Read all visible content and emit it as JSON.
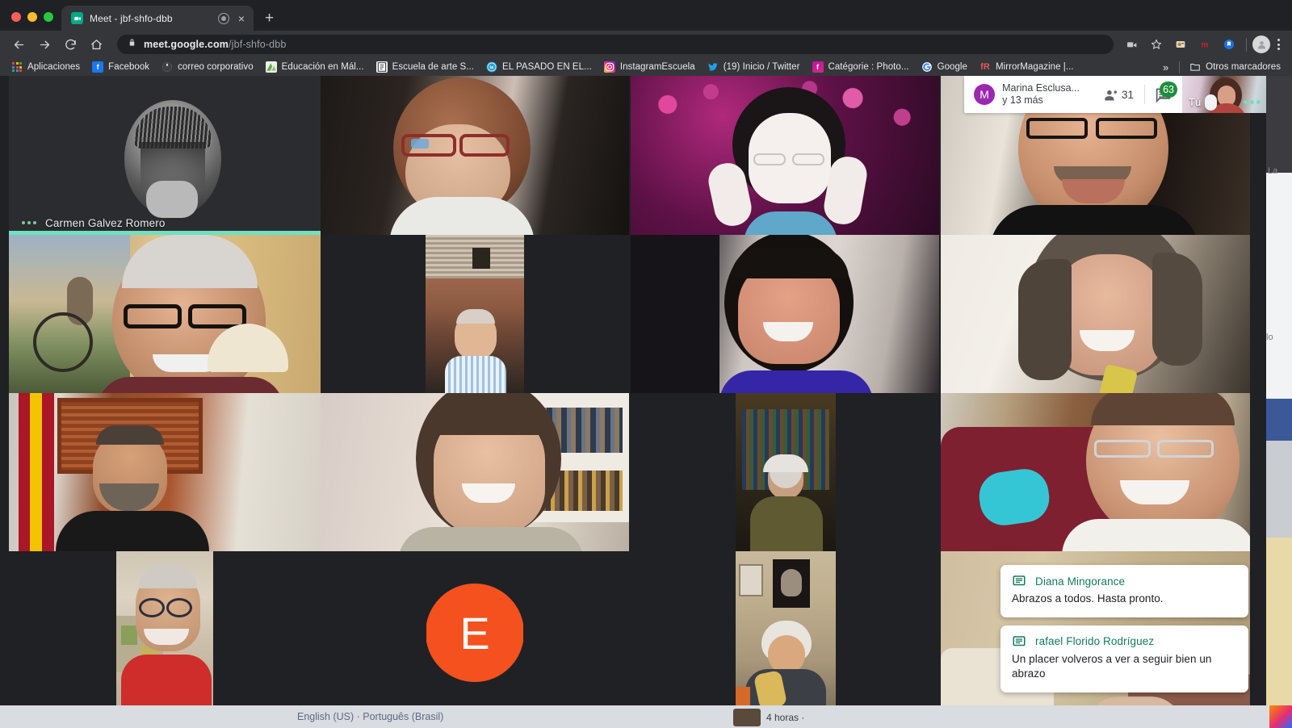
{
  "browser": {
    "tab": {
      "title": "Meet - jbf-shfo-dbb",
      "favicon": "meet-icon",
      "audio_indicator": "audio-playing-icon",
      "close": "×"
    },
    "newtab_label": "+",
    "nav": {
      "back": "back-icon",
      "forward": "forward-icon",
      "reload": "reload-icon",
      "home": "home-icon"
    },
    "omnibox": {
      "lock": "lock-icon",
      "domain": "meet.google.com",
      "path": "/jbf-shfo-dbb"
    },
    "toolbar_icons": [
      "camera-icon",
      "star-icon",
      "extension-puzzle-icon",
      "mendeley-icon",
      "pocket-icon",
      "profile-avatar",
      "chrome-menu-icon"
    ],
    "bookmarks": [
      {
        "label": "Aplicaciones",
        "icon": "apps-grid-icon",
        "color": "#4285f4"
      },
      {
        "label": "Facebook",
        "icon": "facebook-icon",
        "color": "#1877f2"
      },
      {
        "label": "correo corporativo",
        "icon": "globe-icon",
        "color": "#ffffff"
      },
      {
        "label": "Educación en Mál...",
        "icon": "mountain-icon",
        "color": "#e8f5e9"
      },
      {
        "label": "Escuela de arte S...",
        "icon": "document-icon",
        "color": "#f1f3f4"
      },
      {
        "label": "EL PASADO EN EL...",
        "icon": "wordpress-icon",
        "color": "#21759b"
      },
      {
        "label": "InstagramEscuela",
        "icon": "instagram-icon",
        "color": "#e1306c"
      },
      {
        "label": "(19) Inicio / Twitter",
        "icon": "twitter-icon",
        "color": "#1da1f2"
      },
      {
        "label": "Catégorie : Photo...",
        "icon": "flickr-icon",
        "color": "#c13584"
      },
      {
        "label": "Google",
        "icon": "google-icon",
        "color": "#4285f4"
      },
      {
        "label": "MirrorMagazine |...",
        "icon": "mirror-icon",
        "color": "#ea4335"
      }
    ],
    "bookmarks_overflow": "»",
    "other_bookmarks": {
      "label": "Otros marcadores",
      "icon": "folder-icon"
    }
  },
  "meet": {
    "top_pill": {
      "speaker_avatar_letter": "M",
      "speaker_avatar_color": "#9c27b0",
      "speaker_name_line1": "Marina Esclusa...",
      "speaker_name_line2": "y 13 más",
      "participants_icon": "people-icon",
      "participants_count": "31",
      "chat_icon": "chat-icon",
      "chat_badge": "63",
      "chat_badge_color": "#1e8e3e"
    },
    "self_view": {
      "label": "Tú",
      "more_icon": "more-dots-icon",
      "mic_icon": "mic-pill-icon"
    },
    "speaking_indicator_color": "#6fe0c0",
    "tiles": [
      {
        "name": "Carmen Galvez Romero",
        "show_name": true,
        "speaking": true,
        "kind": "avatar-photo"
      },
      {
        "name": "",
        "show_name": false,
        "speaking": false,
        "kind": "video"
      },
      {
        "name": "",
        "show_name": false,
        "speaking": false,
        "kind": "video"
      },
      {
        "name": "",
        "show_name": false,
        "speaking": false,
        "kind": "video"
      },
      {
        "name": "",
        "show_name": false,
        "speaking": false,
        "kind": "video"
      },
      {
        "name": "",
        "show_name": false,
        "speaking": false,
        "kind": "video"
      },
      {
        "name": "",
        "show_name": false,
        "speaking": false,
        "kind": "video"
      },
      {
        "name": "",
        "show_name": false,
        "speaking": false,
        "kind": "video"
      },
      {
        "name": "",
        "show_name": false,
        "speaking": false,
        "kind": "video"
      },
      {
        "name": "",
        "show_name": false,
        "speaking": false,
        "kind": "video"
      },
      {
        "name": "",
        "show_name": false,
        "speaking": false,
        "kind": "video"
      },
      {
        "name": "",
        "show_name": false,
        "speaking": false,
        "kind": "video"
      },
      {
        "name": "",
        "show_name": false,
        "speaking": false,
        "kind": "video"
      },
      {
        "name": "E",
        "show_name": false,
        "speaking": false,
        "kind": "initial-avatar",
        "avatar_letter": "E",
        "avatar_color": "#f4511e"
      },
      {
        "name": "",
        "show_name": false,
        "speaking": false,
        "kind": "video"
      },
      {
        "name": "",
        "show_name": false,
        "speaking": false,
        "kind": "video"
      }
    ],
    "chat_toasts": [
      {
        "icon": "chat-message-icon",
        "author": "Diana Mingorance",
        "message": "Abrazos a todos. Hasta pronto."
      },
      {
        "icon": "chat-message-icon",
        "author": "rafael Florido Rodríguez",
        "message": "Un placer volveros a ver a seguir bien un abrazo"
      }
    ]
  },
  "background_page": {
    "languages": "English (US) · Português (Brasil)",
    "duration": "4 horas · "
  }
}
